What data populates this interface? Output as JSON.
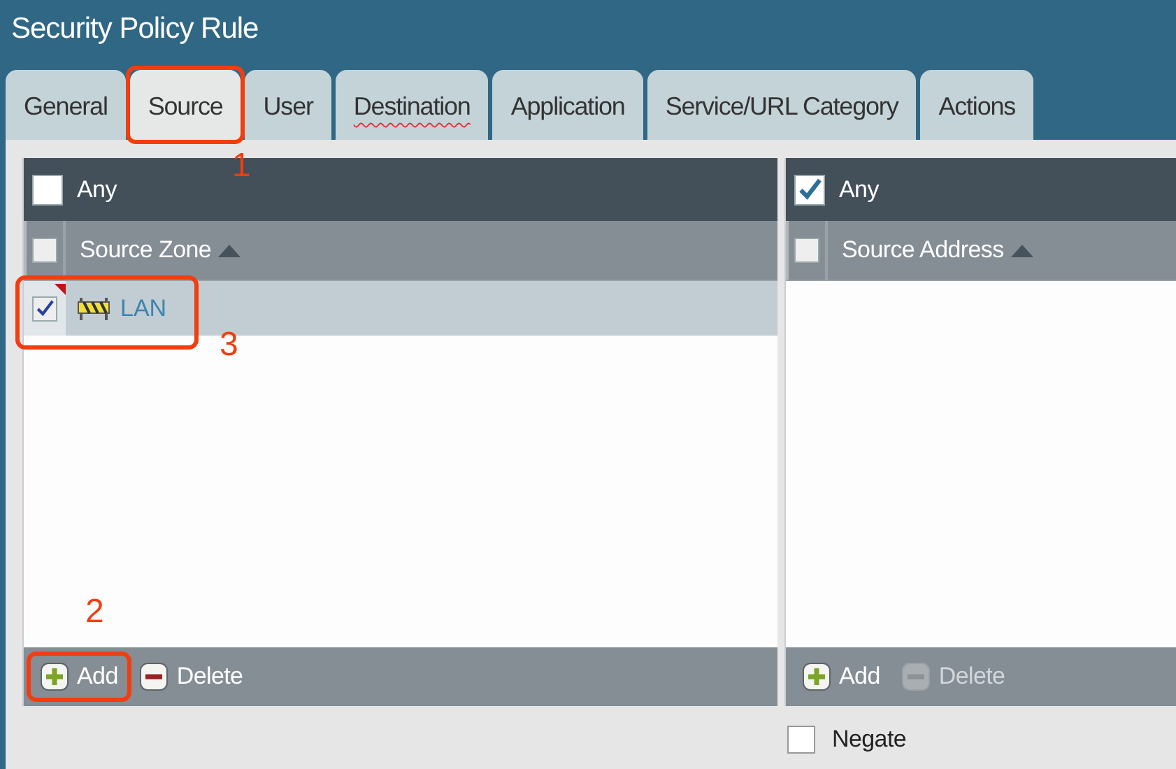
{
  "window": {
    "title": "Security Policy Rule"
  },
  "tabs": [
    {
      "label": "General",
      "selected": false,
      "spell_error": false
    },
    {
      "label": "Source",
      "selected": true,
      "spell_error": false,
      "annotation": "1"
    },
    {
      "label": "User",
      "selected": false,
      "spell_error": false
    },
    {
      "label": "Destination",
      "selected": false,
      "spell_error": true
    },
    {
      "label": "Application",
      "selected": false,
      "spell_error": false
    },
    {
      "label": "Service/URL Category",
      "selected": false,
      "spell_error": false
    },
    {
      "label": "Actions",
      "selected": false,
      "spell_error": false
    }
  ],
  "panels": [
    {
      "any": {
        "label": "Any",
        "checked": false
      },
      "column": {
        "label": "Source Zone",
        "checked": false
      },
      "rows": [
        {
          "name": "LAN",
          "checked": true,
          "modified": true,
          "annotation": "3"
        }
      ],
      "buttons": [
        {
          "label": "Add",
          "kind": "add",
          "disabled": false,
          "annotation": "2"
        },
        {
          "label": "Delete",
          "kind": "delete",
          "disabled": false
        }
      ]
    },
    {
      "any": {
        "label": "Any",
        "checked": true
      },
      "column": {
        "label": "Source Address",
        "checked": false
      },
      "buttons": [
        {
          "label": "Add",
          "kind": "add",
          "disabled": false
        },
        {
          "label": "Delete",
          "kind": "delete",
          "disabled": true
        }
      ],
      "negate": {
        "label": "Negate",
        "checked": false
      }
    }
  ]
}
